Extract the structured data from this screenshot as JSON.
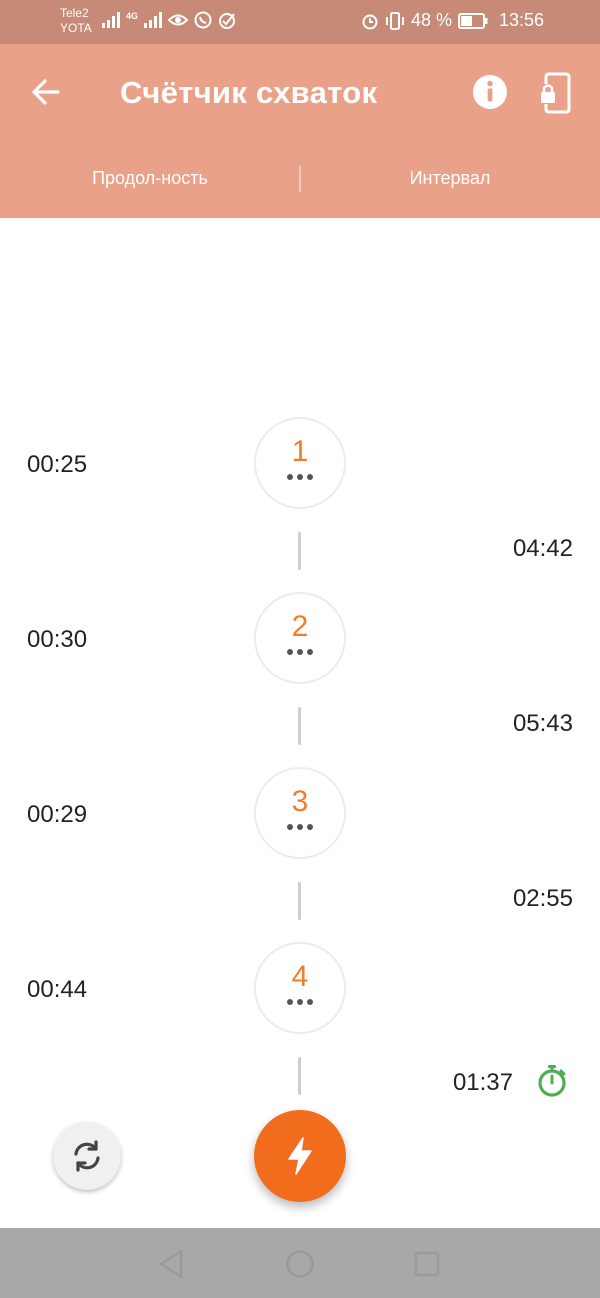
{
  "status_bar": {
    "carrier_1": "Tele2",
    "carrier_2": "YOTA",
    "network_type": "4G",
    "battery": "48 %",
    "time": "13:56"
  },
  "header": {
    "title": "Счётчик схваток",
    "back_icon": "arrow-left-icon",
    "info_icon": "info-icon",
    "lock_icon": "lock-phone-icon"
  },
  "tabs": {
    "duration": "Продол-ность",
    "interval": "Интервал"
  },
  "contractions": [
    {
      "number": "1",
      "duration": "00:25",
      "interval": "04:42"
    },
    {
      "number": "2",
      "duration": "00:30",
      "interval": "05:43"
    },
    {
      "number": "3",
      "duration": "00:29",
      "interval": "02:55"
    },
    {
      "number": "4",
      "duration": "00:44",
      "interval": "01:37"
    }
  ],
  "actions": {
    "reset_icon": "refresh-icon",
    "main_icon": "lightning-icon",
    "timer_icon": "stopwatch-icon"
  },
  "colors": {
    "accent": "#f26c1e",
    "header": "#e9a189",
    "status_bar": "#c68a76",
    "timer_green": "#4caf50",
    "number_orange": "#f07d2e"
  }
}
